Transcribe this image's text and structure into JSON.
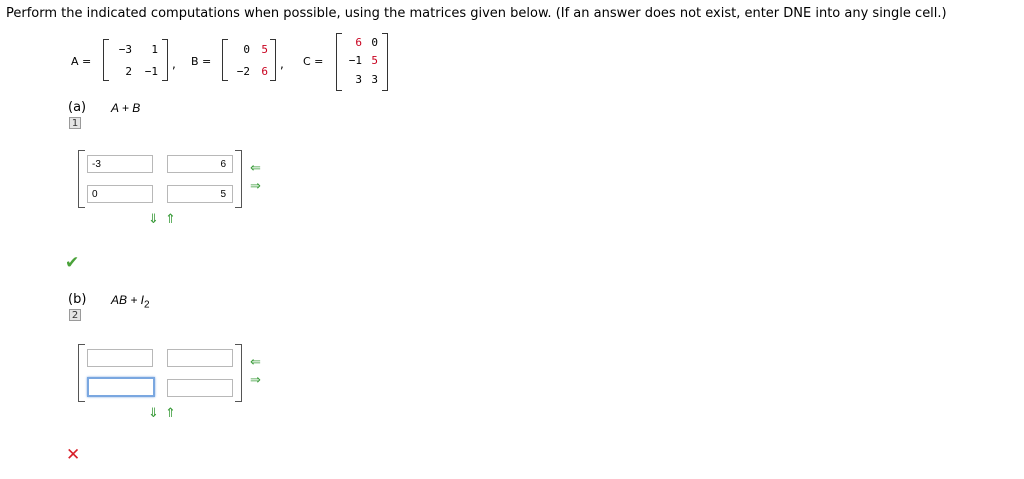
{
  "instructions": "Perform the indicated computations when possible, using the matrices given below. (If an answer does not exist, enter DNE into any single cell.)",
  "matrices": {
    "A": {
      "label": "A =",
      "rows": [
        [
          "−3",
          "1"
        ],
        [
          "2",
          "−1"
        ]
      ]
    },
    "B": {
      "label": "B =",
      "rows": [
        [
          "0",
          "5"
        ],
        [
          "−2",
          "6"
        ]
      ]
    },
    "C": {
      "label": "C =",
      "rows": [
        [
          "6",
          "0"
        ],
        [
          "−1",
          "5"
        ],
        [
          "3",
          "3"
        ]
      ]
    }
  },
  "separator": ",",
  "parts": [
    {
      "letter": "(a)",
      "number": "1",
      "expression": "A + B",
      "cells": [
        "-3",
        "6",
        "0",
        "5"
      ],
      "status": "correct"
    },
    {
      "letter": "(b)",
      "number": "2",
      "expression_main": "AB + I",
      "expression_sub": "2",
      "cells": [
        "",
        "",
        "",
        ""
      ],
      "status": "incorrect"
    }
  ],
  "icons": {
    "add_column": "left-arrow-icon",
    "remove_column": "right-arrow-icon",
    "add_row": "down-arrow-icon",
    "remove_row": "up-arrow-icon",
    "correct": "check-icon",
    "incorrect": "x-icon"
  },
  "colors": {
    "highlight_values": "#c8001e",
    "arrows": "#3a9b3a",
    "check": "#4aa23a",
    "cross": "#d8202a",
    "focus": "#7aa7e0"
  }
}
